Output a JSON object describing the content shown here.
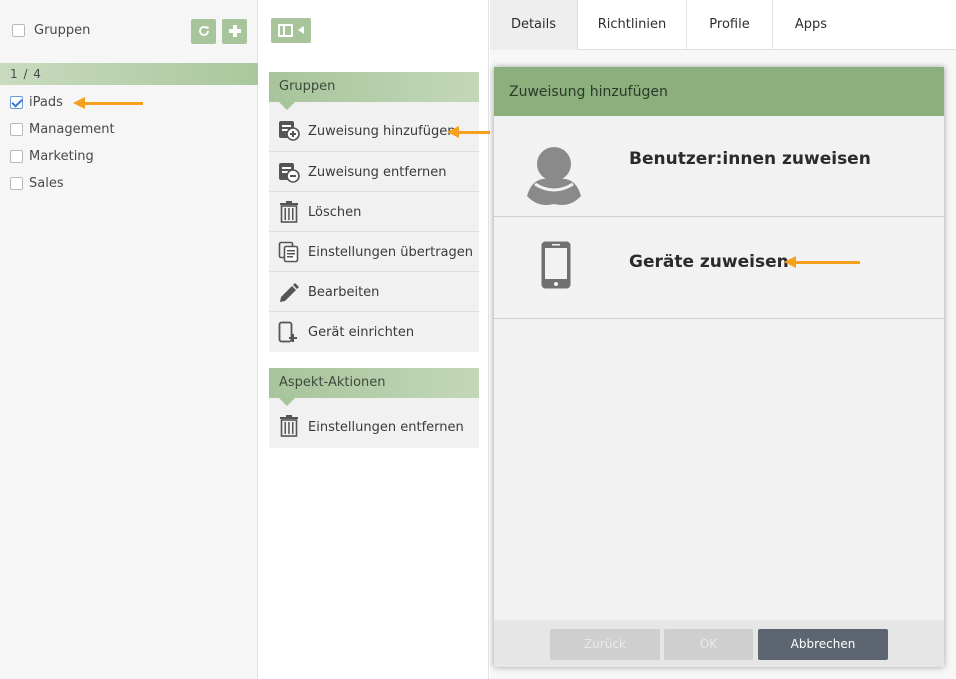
{
  "left": {
    "header_title": "Gruppen",
    "count": "1 / 4",
    "refresh_icon": "refresh-icon",
    "add_icon": "plus-icon",
    "groups": [
      {
        "label": "iPads",
        "checked": true
      },
      {
        "label": "Management",
        "checked": false
      },
      {
        "label": "Marketing",
        "checked": false
      },
      {
        "label": "Sales",
        "checked": false
      }
    ]
  },
  "middle": {
    "collapse_icon": "sidebar-collapse-icon",
    "groups_panel": {
      "title": "Gruppen",
      "actions": [
        {
          "label": "Zuweisung hinzufügen",
          "icon": "add-assignment-icon"
        },
        {
          "label": "Zuweisung entfernen",
          "icon": "remove-assignment-icon"
        },
        {
          "label": "Löschen",
          "icon": "trash-icon"
        },
        {
          "label": "Einstellungen übertragen",
          "icon": "copy-settings-icon"
        },
        {
          "label": "Bearbeiten",
          "icon": "pencil-icon"
        },
        {
          "label": "Gerät einrichten",
          "icon": "device-setup-icon"
        }
      ]
    },
    "aspect_panel": {
      "title": "Aspekt-Aktionen",
      "actions": [
        {
          "label": "Einstellungen entfernen",
          "icon": "trash-icon"
        }
      ]
    }
  },
  "tabs": [
    {
      "label": "Details",
      "active": true
    },
    {
      "label": "Richtlinien",
      "active": false
    },
    {
      "label": "Profile",
      "active": false
    },
    {
      "label": "Apps",
      "active": false
    }
  ],
  "modal": {
    "title": "Zuweisung hinzufügen",
    "options": [
      {
        "label": "Benutzer:innen zuweisen",
        "icon": "user-avatar-icon"
      },
      {
        "label": "Geräte zuweisen",
        "icon": "smartphone-icon"
      }
    ],
    "buttons": {
      "back": "Zurück",
      "ok": "OK",
      "cancel": "Abbrechen"
    }
  },
  "colors": {
    "accent_green": "#8cb07d",
    "light_green": "#a7c49b",
    "annotation_arrow": "#f5a11d",
    "cancel_button": "#5d6670"
  }
}
